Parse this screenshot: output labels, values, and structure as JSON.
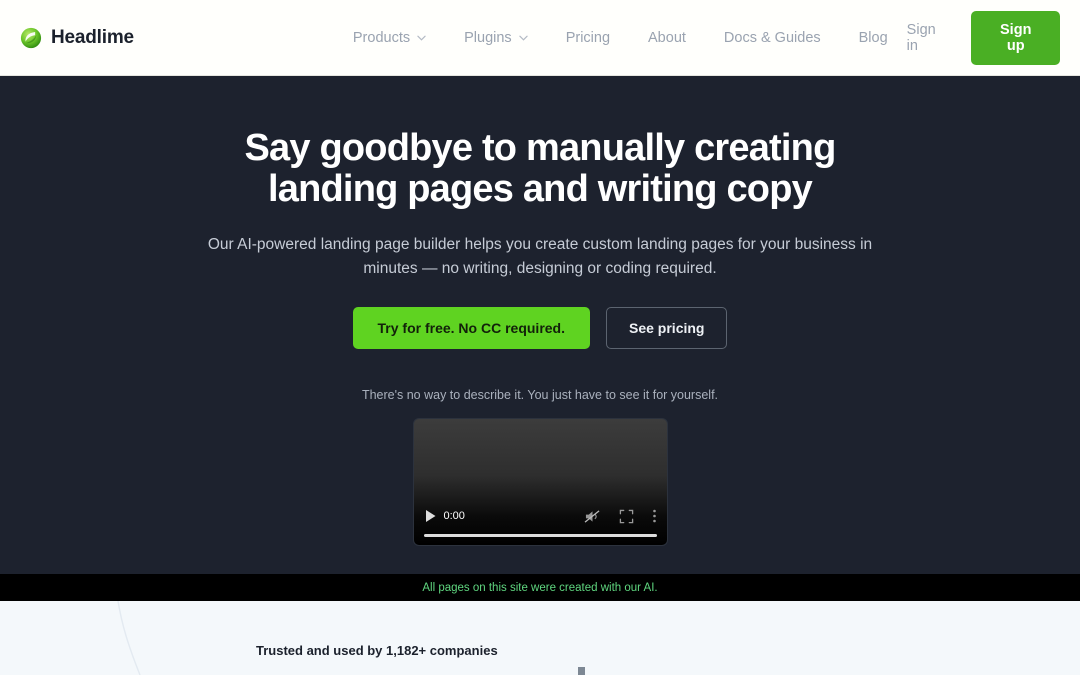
{
  "brand": {
    "name": "Headlime",
    "logo_icon": "headlime-swirl-logo",
    "accent": "#5fd321"
  },
  "header": {
    "nav": [
      {
        "label": "Products",
        "has_dropdown": true,
        "icon": "chevron-down-icon"
      },
      {
        "label": "Plugins",
        "has_dropdown": true,
        "icon": "chevron-down-icon"
      },
      {
        "label": "Pricing",
        "has_dropdown": false,
        "icon": ""
      },
      {
        "label": "About",
        "has_dropdown": false,
        "icon": ""
      },
      {
        "label": "Docs & Guides",
        "has_dropdown": false,
        "icon": ""
      },
      {
        "label": "Blog",
        "has_dropdown": false,
        "icon": ""
      }
    ],
    "sign_in": "Sign in",
    "sign_up": "Sign up",
    "sign_up_color": "#4aaf24",
    "background": "#fffffc"
  },
  "hero": {
    "title_line1": "Say goodbye to manually creating",
    "title_line2": "landing pages and writing copy",
    "subtitle": "Our AI-powered landing page builder helps you create custom landing pages for your business in minutes — no writing, designing or coding required.",
    "primary_cta": "Try for free. No CC required.",
    "secondary_cta": "See pricing",
    "video_caption": "There's no way to describe it. You just have to see it for yourself.",
    "background": "#1d222e"
  },
  "video": {
    "current_time": "0:00",
    "play_icon": "play-icon",
    "volume_icon": "volume-muted-icon",
    "fullscreen_icon": "fullscreen-icon",
    "menu_icon": "kebab-menu-icon",
    "progress_percent": 0
  },
  "ai_banner": {
    "text": "All pages on this site were created with our AI.",
    "text_color": "#5fd67f",
    "background": "#000000"
  },
  "trusted": {
    "label": "Trusted and used by 1,182+ companies",
    "logos": [
      {
        "name": "partner-logo-1",
        "text": ""
      },
      {
        "name": "partner-logo-2",
        "text": ""
      },
      {
        "name": "partner-logo-3",
        "text": ""
      },
      {
        "name": "partner-logo-4",
        "text": ""
      },
      {
        "name": "partner-logo-5",
        "text": ""
      },
      {
        "name": "partner-logo-6",
        "text": ""
      }
    ]
  }
}
